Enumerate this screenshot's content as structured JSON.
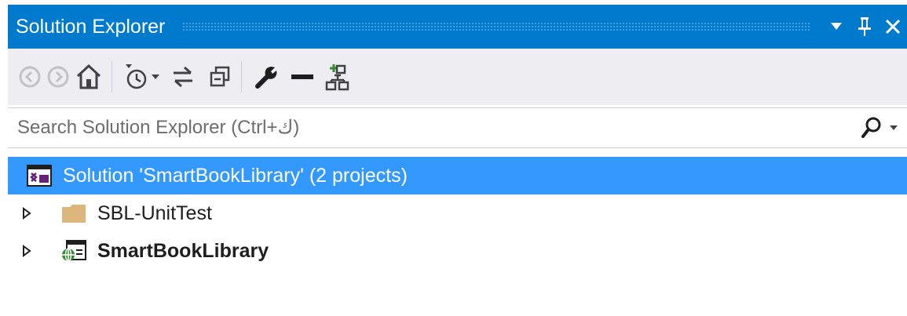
{
  "window": {
    "title": "Solution Explorer",
    "dropdown_icon": "caret-down-icon",
    "pin_icon": "pin-icon",
    "close_icon": "close-icon"
  },
  "toolbar": {
    "items": [
      {
        "name": "back-button",
        "icon": "back-arrow-icon"
      },
      {
        "name": "forward-button",
        "icon": "forward-arrow-icon"
      },
      {
        "name": "home-button",
        "icon": "home-icon"
      },
      {
        "name": "pending-changes-filter-button",
        "icon": "clock-filter-icon"
      },
      {
        "name": "sync-with-active-document-button",
        "icon": "sync-arrows-icon"
      },
      {
        "name": "collapse-all-button",
        "icon": "collapse-all-icon"
      },
      {
        "name": "properties-button",
        "icon": "wrench-icon"
      },
      {
        "name": "preview-selected-items-button",
        "icon": "minus-icon"
      },
      {
        "name": "view-class-diagram-button",
        "icon": "class-diagram-icon"
      }
    ]
  },
  "search": {
    "placeholder": "Search Solution Explorer (Ctrl+ك)",
    "icon": "search-icon"
  },
  "tree": {
    "solution": {
      "label": "Solution 'SmartBookLibrary' (2 projects)",
      "icon": "solution-icon",
      "selected": true
    },
    "projects": [
      {
        "label": "SBL-UnitTest",
        "icon": "folder-icon",
        "bold": false,
        "expanded": false
      },
      {
        "label": "SmartBookLibrary",
        "icon": "web-project-icon",
        "bold": true,
        "expanded": false
      }
    ]
  },
  "colors": {
    "titlebar": "#007acc",
    "toolbar": "#eeeef2",
    "selection": "#3399ff",
    "text": "#1e1e1e",
    "placeholder": "#6d6d6d"
  }
}
